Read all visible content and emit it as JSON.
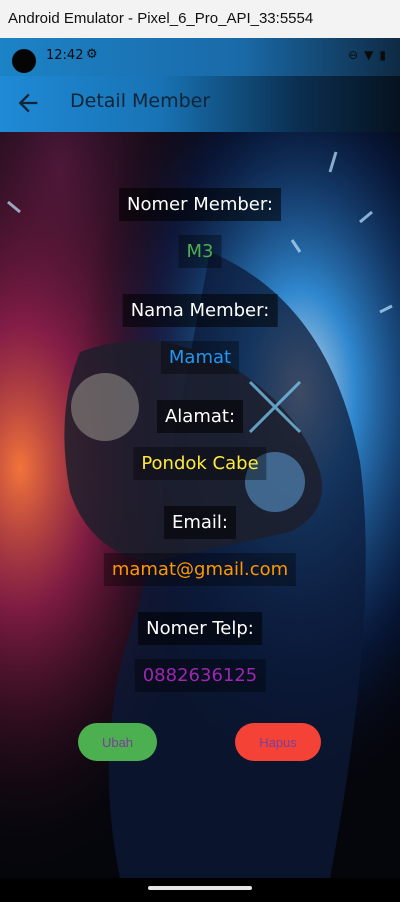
{
  "window": {
    "title": "Android Emulator - Pixel_6_Pro_API_33:5554"
  },
  "status_bar": {
    "time": "12:42"
  },
  "app_bar": {
    "title": "Detail Member"
  },
  "fields": [
    {
      "label": "Nomer Member:",
      "value": "M3",
      "value_color": "#4caf50"
    },
    {
      "label": "Nama Member:",
      "value": "Mamat",
      "value_color": "#2196f3"
    },
    {
      "label": "Alamat:",
      "value": "Pondok Cabe",
      "value_color": "#ffeb3b"
    },
    {
      "label": "Email:",
      "value": "mamat@gmail.com",
      "value_color": "#ff9800"
    },
    {
      "label": "Nomer Telp:",
      "value": "0882636125",
      "value_color": "#9c27b0"
    }
  ],
  "buttons": {
    "edit": {
      "label": "Ubah",
      "bg": "#4caf50",
      "text_color": "#7b3f99"
    },
    "delete": {
      "label": "Hapus",
      "bg": "#f44336",
      "text_color": "#7b3f99"
    }
  }
}
